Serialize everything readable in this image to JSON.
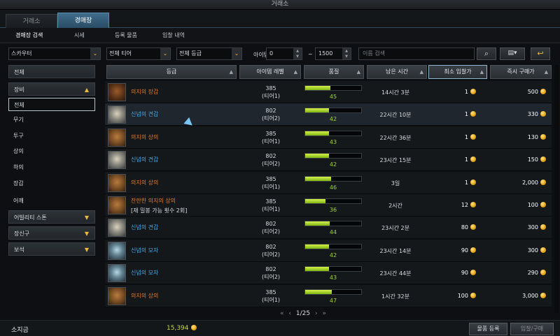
{
  "window": {
    "title": "거래소"
  },
  "tabs": [
    {
      "label": "거래소"
    },
    {
      "label": "경매장"
    }
  ],
  "subtabs": [
    {
      "label": "경매장 검색"
    },
    {
      "label": "시세"
    },
    {
      "label": "등록 물품"
    },
    {
      "label": "입찰 내역"
    }
  ],
  "filters": {
    "class": "스카우터",
    "tier": "전체 티어",
    "grade": "전체 등급",
    "level_label": "아이템 레벨",
    "level_min": "0",
    "level_tilde": "~",
    "level_max": "1500",
    "search_placeholder": "이름 검색",
    "search_icon": "search-icon",
    "filter_icon": "filter-settings-icon",
    "reset_icon": "reset-icon"
  },
  "sidebar": {
    "items": [
      {
        "label": "전체",
        "kind": "cat"
      },
      {
        "label": "장비",
        "kind": "cat",
        "expanded": true
      },
      {
        "label": "전체",
        "kind": "sub",
        "selected": true
      },
      {
        "label": "무기",
        "kind": "sub"
      },
      {
        "label": "투구",
        "kind": "sub"
      },
      {
        "label": "상의",
        "kind": "sub"
      },
      {
        "label": "하의",
        "kind": "sub"
      },
      {
        "label": "장갑",
        "kind": "sub"
      },
      {
        "label": "어깨",
        "kind": "sub"
      },
      {
        "label": "어빌리티 스톤",
        "kind": "cat"
      },
      {
        "label": "장신구",
        "kind": "cat"
      },
      {
        "label": "보석",
        "kind": "cat"
      }
    ]
  },
  "table": {
    "headers": [
      "등급",
      "아이템 레벨",
      "품질",
      "남은 시간",
      "최소 입찰가",
      "즉시 구매가"
    ],
    "rows": [
      {
        "name": "의지의 장갑",
        "sub": "",
        "color": "#e07a2c",
        "icon": "gloves-icon",
        "level": "385",
        "tier": "(티어1)",
        "quality": 45,
        "time": "14시간 3분",
        "min_bid": "1",
        "buyout": "500"
      },
      {
        "name": "신념의 견갑",
        "sub": "",
        "color": "#4aa9e6",
        "icon": "shoulder-icon",
        "level": "802",
        "tier": "(티어2)",
        "quality": 42,
        "time": "22시간 10분",
        "min_bid": "1",
        "buyout": "330"
      },
      {
        "name": "의지의 상의",
        "sub": "",
        "color": "#e07a2c",
        "icon": "chest-armor-icon",
        "level": "385",
        "tier": "(티어1)",
        "quality": 43,
        "time": "22시간 36분",
        "min_bid": "1",
        "buyout": "130"
      },
      {
        "name": "신념의 견갑",
        "sub": "",
        "color": "#4aa9e6",
        "icon": "shoulder-icon",
        "level": "802",
        "tier": "(티어2)",
        "quality": 42,
        "time": "23시간 15분",
        "min_bid": "1",
        "buyout": "150"
      },
      {
        "name": "의지의 상의",
        "sub": "",
        "color": "#e07a2c",
        "icon": "chest-armor-icon",
        "level": "385",
        "tier": "(티어1)",
        "quality": 46,
        "time": "3일",
        "min_bid": "1",
        "buyout": "2,000"
      },
      {
        "name": "찬란한 의지의 상의",
        "sub": "[재 밀봉 가능 횟수 2회]",
        "color": "#e07a2c",
        "icon": "chest-armor-icon",
        "level": "385",
        "tier": "(티어1)",
        "quality": 36,
        "time": "2시간",
        "min_bid": "12",
        "buyout": "100"
      },
      {
        "name": "신념의 견갑",
        "sub": "",
        "color": "#4aa9e6",
        "icon": "shoulder-icon",
        "level": "802",
        "tier": "(티어2)",
        "quality": 44,
        "time": "23시간 2분",
        "min_bid": "80",
        "buyout": "300"
      },
      {
        "name": "신념의 모자",
        "sub": "",
        "color": "#4aa9e6",
        "icon": "helmet-icon",
        "level": "802",
        "tier": "(티어2)",
        "quality": 42,
        "time": "23시간 14분",
        "min_bid": "90",
        "buyout": "300"
      },
      {
        "name": "신념의 모자",
        "sub": "",
        "color": "#4aa9e6",
        "icon": "helmet-icon",
        "level": "802",
        "tier": "(티어2)",
        "quality": 43,
        "time": "23시간 44분",
        "min_bid": "90",
        "buyout": "290"
      },
      {
        "name": "의지의 상의",
        "sub": "",
        "color": "#e07a2c",
        "icon": "chest-armor-icon",
        "level": "385",
        "tier": "(티어1)",
        "quality": 47,
        "time": "1시간 32분",
        "min_bid": "100",
        "buyout": "3,000"
      }
    ]
  },
  "pager": {
    "first": "«",
    "prev": "‹",
    "page": "1/25",
    "next": "›",
    "last": "»"
  },
  "footer": {
    "gold_label": "소지금",
    "gold_value": "15,394",
    "register_button": "물품 등록",
    "bid_button": "입찰/구매"
  }
}
